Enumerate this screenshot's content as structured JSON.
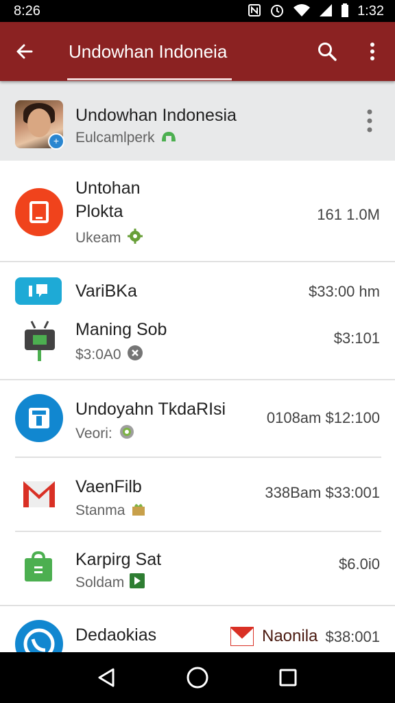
{
  "status_bar": {
    "time_left": "8:26",
    "time_right": "1:32",
    "icons": [
      "nfc-icon",
      "alarm-icon",
      "wifi-icon",
      "signal-icon",
      "battery-icon"
    ]
  },
  "app_bar": {
    "title": "Undowhan Indoneia",
    "background": "#8b2222"
  },
  "header": {
    "name": "Undowhan Indonesia",
    "subtitle": "Eulcamlperk"
  },
  "list": [
    {
      "title_line1": "Untohan",
      "title_line2": "Plokta",
      "subtitle": "Ukeam",
      "amount": "161 1.0M",
      "icon": "red-tablet-icon"
    },
    {
      "title": "VariBKa",
      "amount": "$33:00 hm",
      "icon": "cyan-chat-icon"
    },
    {
      "title": "Maning Sob",
      "subtitle": "$3:0A0",
      "amount": "$3:101",
      "icon": "android-robot-icon"
    },
    {
      "title": "Undoyahn TkdaRIsi",
      "subtitle": "Veori:",
      "amount": "0108am $12:100",
      "icon": "blue-lock-icon"
    },
    {
      "title": "VaenFilb",
      "subtitle": "Stanma",
      "amount": "338Bam $33:001",
      "icon": "gmail-icon"
    },
    {
      "title": "Karpirg Sat",
      "subtitle": "Soldam",
      "amount": "$6.0i0",
      "icon": "green-bag-icon"
    },
    {
      "title": "Dedaokias",
      "amount_label": "Naonila",
      "amount": "$38:001",
      "icon": "blue-phone-icon"
    }
  ],
  "nav": {
    "back": "back-icon",
    "home": "home-icon",
    "recents": "recents-icon"
  }
}
